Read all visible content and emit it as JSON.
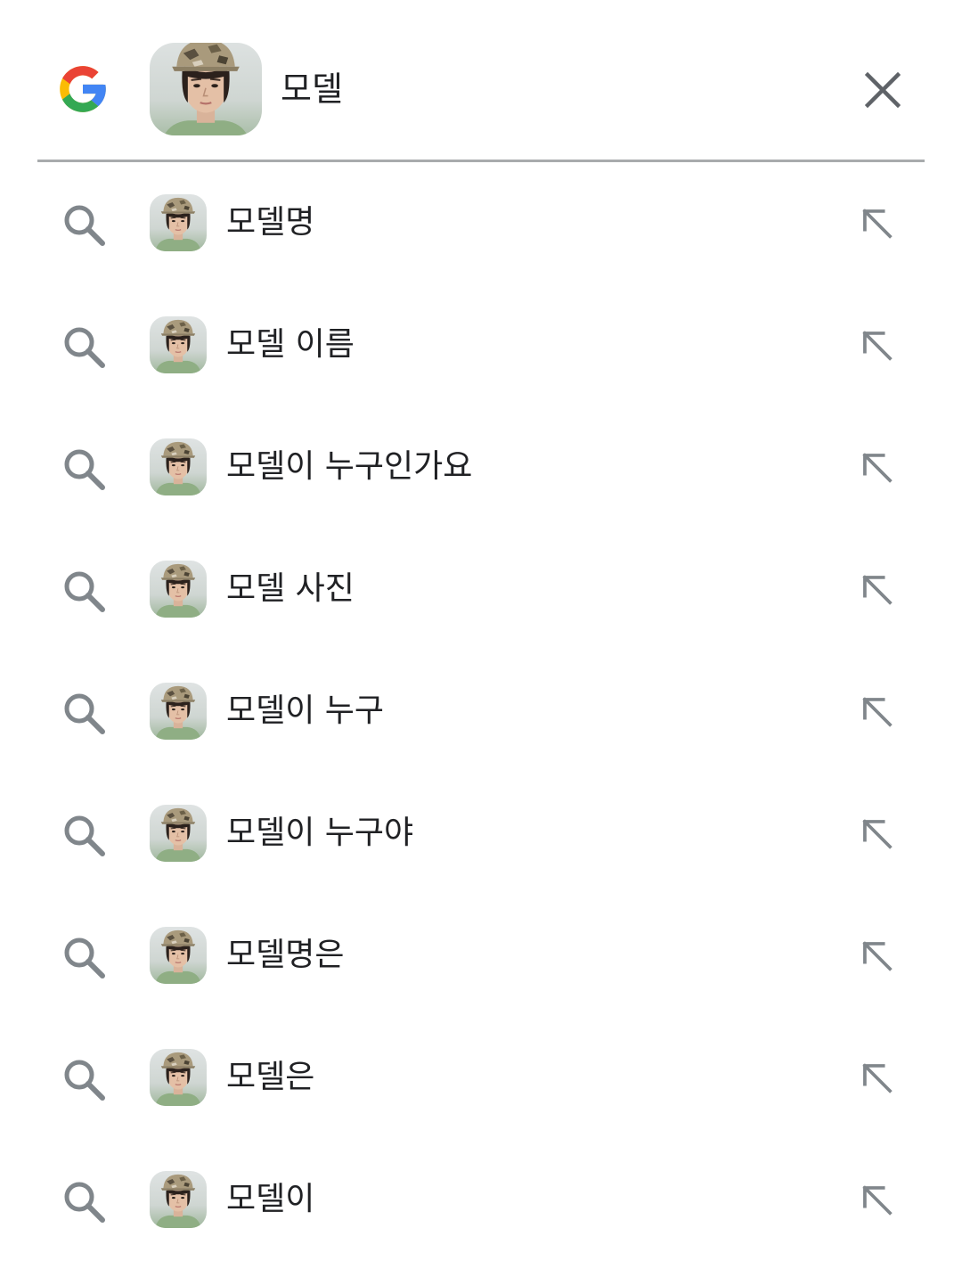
{
  "search": {
    "query": "모델",
    "clear_icon": "close-icon",
    "logo_icon": "google-g-logo",
    "colors": {
      "text": "#202124",
      "icon_gray": "#80868b",
      "divider": "#a8abad",
      "google_blue": "#4285F4",
      "google_red": "#EA4335",
      "google_yellow": "#FBBC05",
      "google_green": "#34A853"
    }
  },
  "suggestions": [
    {
      "text": "모델명"
    },
    {
      "text": "모델 이름"
    },
    {
      "text": "모델이 누구인가요"
    },
    {
      "text": "모델 사진"
    },
    {
      "text": "모델이 누구"
    },
    {
      "text": "모델이 누구야"
    },
    {
      "text": "모델명은"
    },
    {
      "text": "모델은"
    },
    {
      "text": "모델이"
    }
  ]
}
